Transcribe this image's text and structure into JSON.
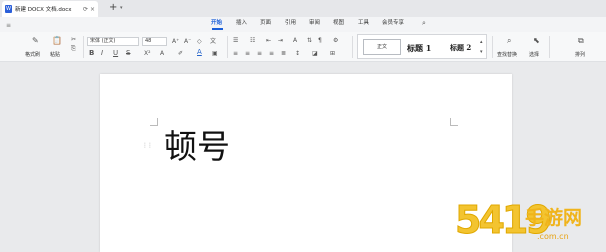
{
  "tab": {
    "title": "新建 DOCX 文档.docx",
    "new_tab": "+"
  },
  "menu": {
    "items": [
      "开始",
      "插入",
      "页面",
      "引用",
      "审阅",
      "视图",
      "工具",
      "会员专享"
    ],
    "active": "开始"
  },
  "ribbon": {
    "format_painter": "格式刷",
    "paste": "粘贴",
    "font_name": "宋体 (正文)",
    "font_size": "48",
    "bold": "B",
    "italic": "I",
    "underline": "U",
    "strike": "S",
    "styles": {
      "normal": "正文",
      "heading1": "标题 1",
      "heading2": "标题 2"
    },
    "find_replace": "查找替换",
    "select": "选择",
    "arrange": "排列"
  },
  "document": {
    "text": "顿号"
  },
  "watermark": {
    "number": "5419",
    "brand": "手游网",
    "site": ".com.cn"
  },
  "colors": {
    "accent": "#1a5ed8",
    "watermark": "#f3c430"
  }
}
